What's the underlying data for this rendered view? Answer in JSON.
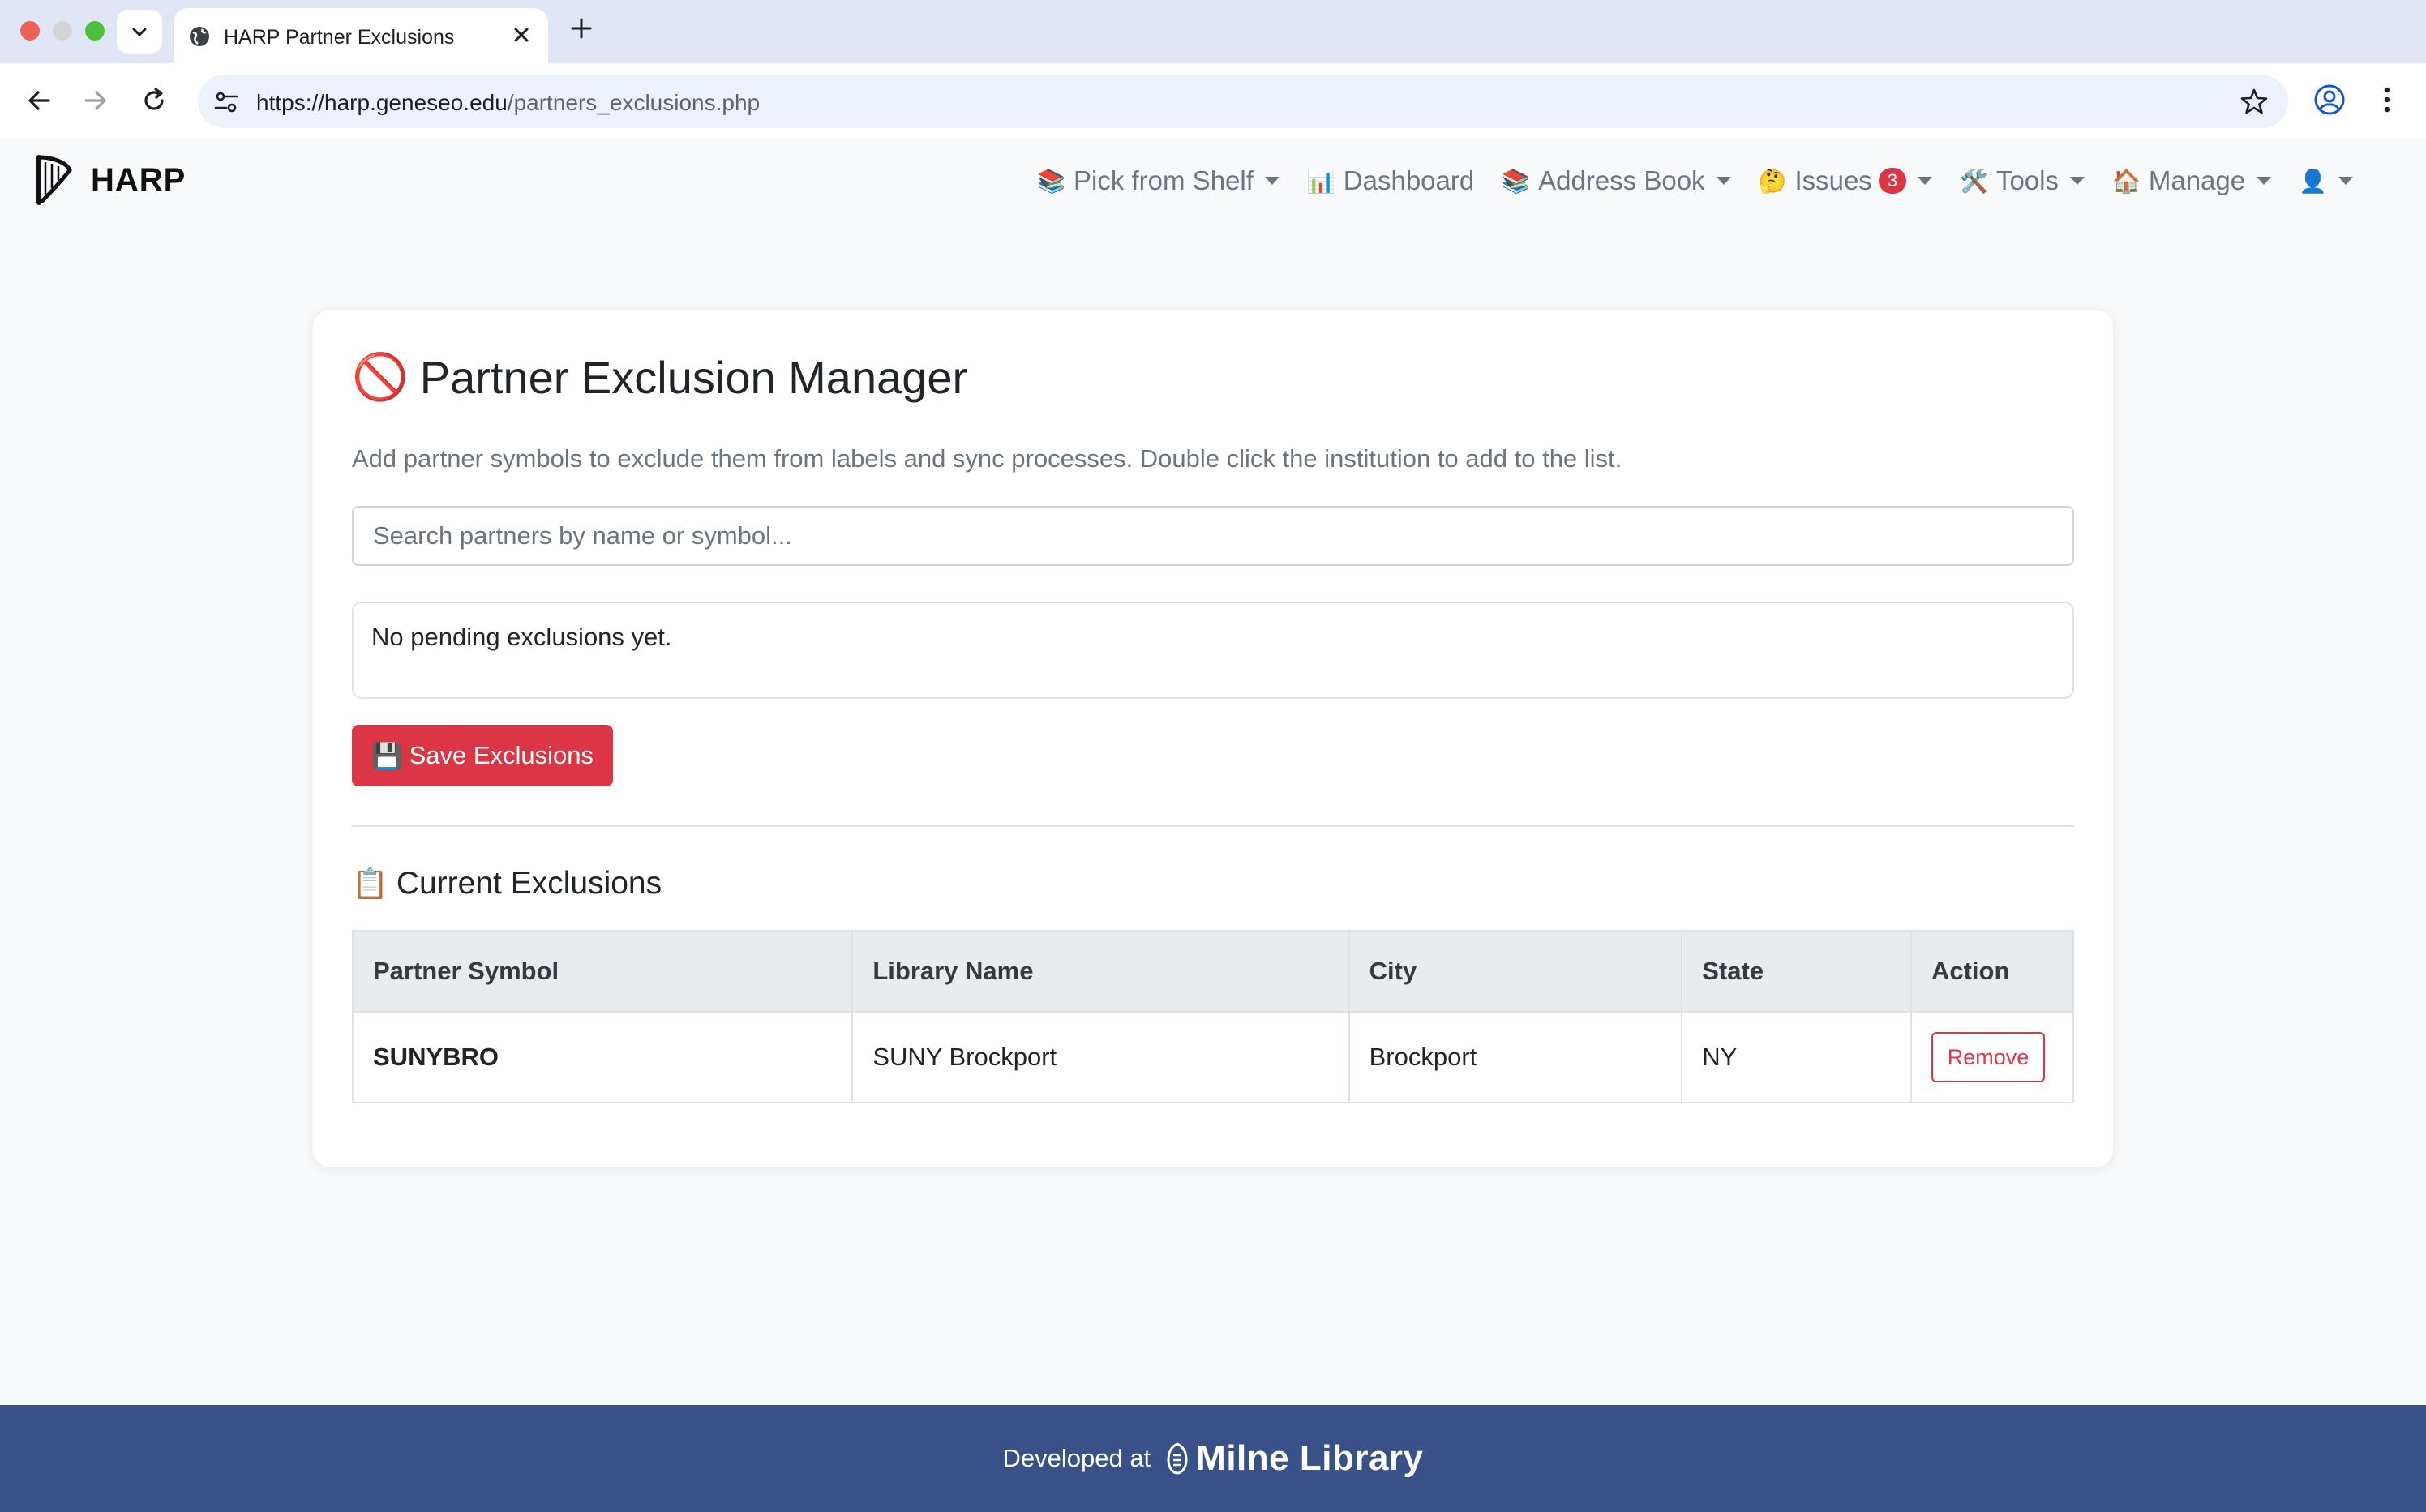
{
  "browser": {
    "tab_title": "HARP Partner Exclusions",
    "url_host": "https://harp.geneseo.edu",
    "url_path": "/partners_exclusions.php"
  },
  "navbar": {
    "brand": "HARP",
    "items": [
      {
        "icon": "books-emoji",
        "emoji": "📚",
        "label": "Pick from Shelf",
        "dropdown": true
      },
      {
        "icon": "bar-chart-emoji",
        "emoji": "📊",
        "label": "Dashboard",
        "dropdown": false
      },
      {
        "icon": "books-emoji",
        "emoji": "📚",
        "label": "Address Book",
        "dropdown": true
      },
      {
        "icon": "thinking-face-emoji",
        "emoji": "🤔",
        "label": "Issues",
        "badge": "3",
        "dropdown": true
      },
      {
        "icon": "tools-emoji",
        "emoji": "🛠️",
        "label": "Tools",
        "dropdown": true
      },
      {
        "icon": "house-emoji",
        "emoji": "🏠",
        "label": "Manage",
        "dropdown": true
      },
      {
        "icon": "user-silhouette-emoji",
        "emoji": "👤",
        "label": "",
        "dropdown": true
      }
    ]
  },
  "page": {
    "title_emoji": "🚫",
    "title": "Partner Exclusion Manager",
    "description": "Add partner symbols to exclude them from labels and sync processes. Double click the institution to add to the list.",
    "search_placeholder": "Search partners by name or symbol...",
    "pending_text": "No pending exclusions yet.",
    "save_emoji": "💾",
    "save_label": "Save Exclusions",
    "section_emoji": "📋",
    "section_title": "Current Exclusions"
  },
  "table": {
    "headers": [
      "Partner Symbol",
      "Library Name",
      "City",
      "State",
      "Action"
    ],
    "rows": [
      {
        "symbol": "SUNYBRO",
        "library": "SUNY Brockport",
        "city": "Brockport",
        "state": "NY",
        "action": "Remove"
      }
    ]
  },
  "footer": {
    "developed_at": "Developed at",
    "library_name": "Milne Library"
  },
  "colors": {
    "danger": "#dc3545",
    "footer_bg": "#3a5089",
    "page_bg": "#f8f9fa"
  }
}
